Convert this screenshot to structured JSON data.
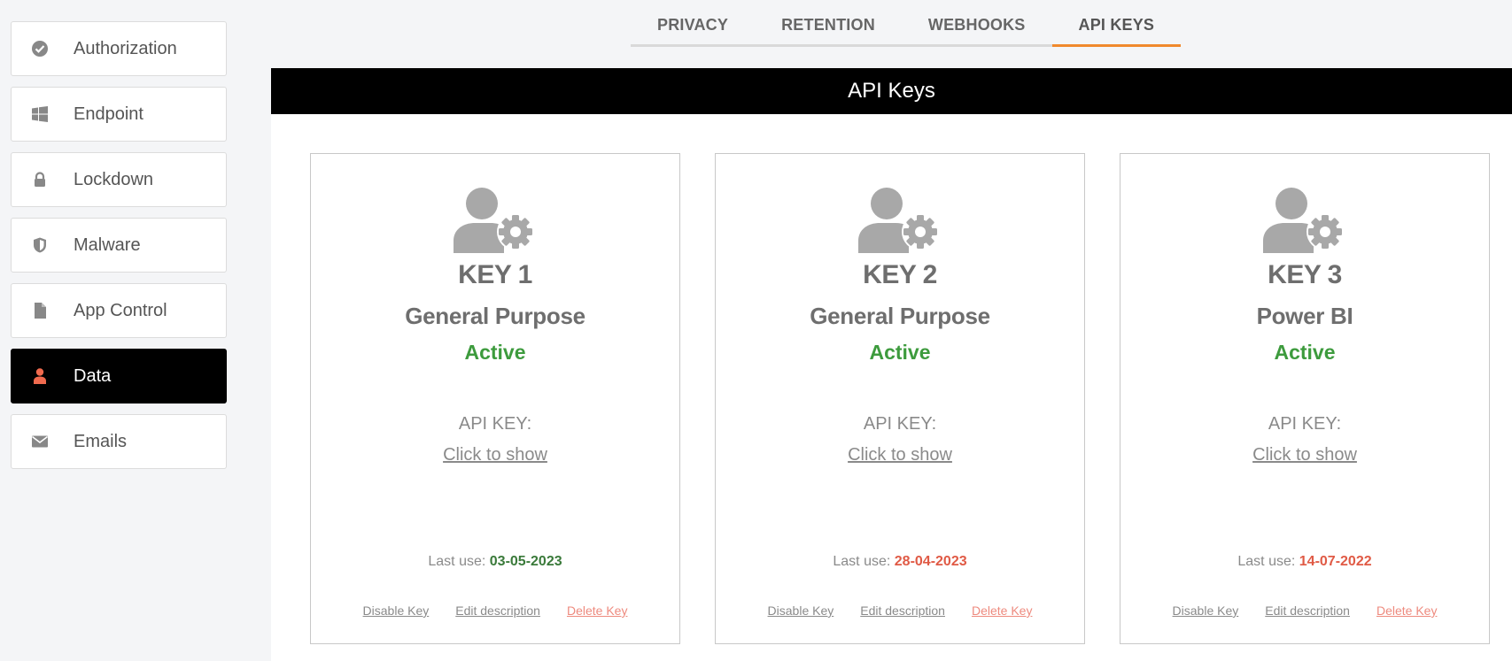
{
  "sidebar": {
    "items": [
      {
        "label": "Authorization",
        "icon": "check-circle-icon"
      },
      {
        "label": "Endpoint",
        "icon": "windows-icon"
      },
      {
        "label": "Lockdown",
        "icon": "lock-icon"
      },
      {
        "label": "Malware",
        "icon": "shield-icon"
      },
      {
        "label": "App Control",
        "icon": "file-icon"
      },
      {
        "label": "Data",
        "icon": "user-icon",
        "active": true
      },
      {
        "label": "Emails",
        "icon": "envelope-icon"
      }
    ]
  },
  "tabs": [
    {
      "label": "PRIVACY"
    },
    {
      "label": "RETENTION"
    },
    {
      "label": "WEBHOOKS"
    },
    {
      "label": "API KEYS",
      "active": true
    }
  ],
  "panel": {
    "title": "API Keys",
    "cards": [
      {
        "title": "KEY 1",
        "purpose": "General Purpose",
        "status": "Active",
        "api_label": "API KEY:",
        "api_action": "Click to show",
        "last_use_label": "Last use:",
        "last_use_date": "03-05-2023",
        "date_color": "#3a7a3a",
        "disable": "Disable Key",
        "edit": "Edit description",
        "delete": "Delete Key"
      },
      {
        "title": "KEY 2",
        "purpose": "General Purpose",
        "status": "Active",
        "api_label": "API KEY:",
        "api_action": "Click to show",
        "last_use_label": "Last use:",
        "last_use_date": "28-04-2023",
        "date_color": "#e05a45",
        "disable": "Disable Key",
        "edit": "Edit description",
        "delete": "Delete Key"
      },
      {
        "title": "KEY 3",
        "purpose": "Power BI",
        "status": "Active",
        "api_label": "API KEY:",
        "api_action": "Click to show",
        "last_use_label": "Last use:",
        "last_use_date": "14-07-2022",
        "date_color": "#e05a45",
        "disable": "Disable Key",
        "edit": "Edit description",
        "delete": "Delete Key"
      }
    ]
  },
  "colors": {
    "accent": "#f0892d",
    "active_status": "#3d9b3d",
    "danger": "#ee8a7e",
    "data_icon": "#f06a4e"
  }
}
